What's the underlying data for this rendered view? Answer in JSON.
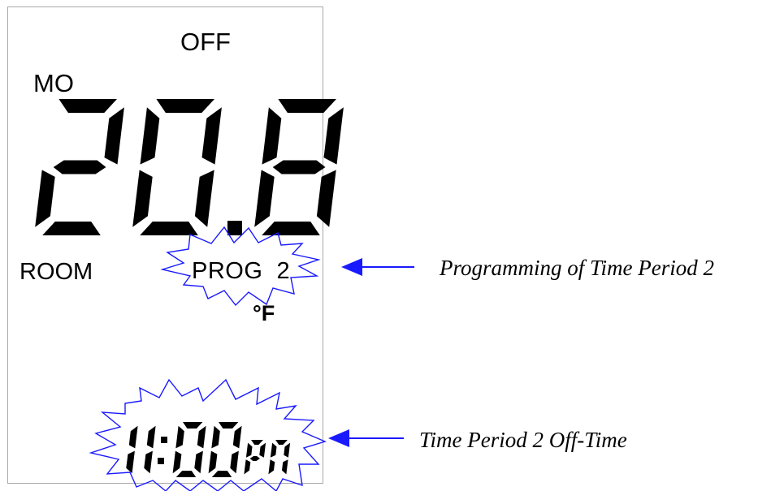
{
  "display": {
    "mode": "OFF",
    "day": "MO",
    "temperature": "20.8",
    "room_label": "ROOM",
    "program_label": "PROG",
    "program_number": "2",
    "unit": "°F",
    "time": "11:00",
    "meridiem": "PM"
  },
  "annotations": {
    "program": "Programming of Time Period 2",
    "time": "Time Period 2 Off-Time"
  },
  "colors": {
    "lcd_segment": "#000000",
    "highlight_burst": "#1a1aff",
    "arrow": "#1a1aff",
    "frame": "#a9a9a9"
  }
}
